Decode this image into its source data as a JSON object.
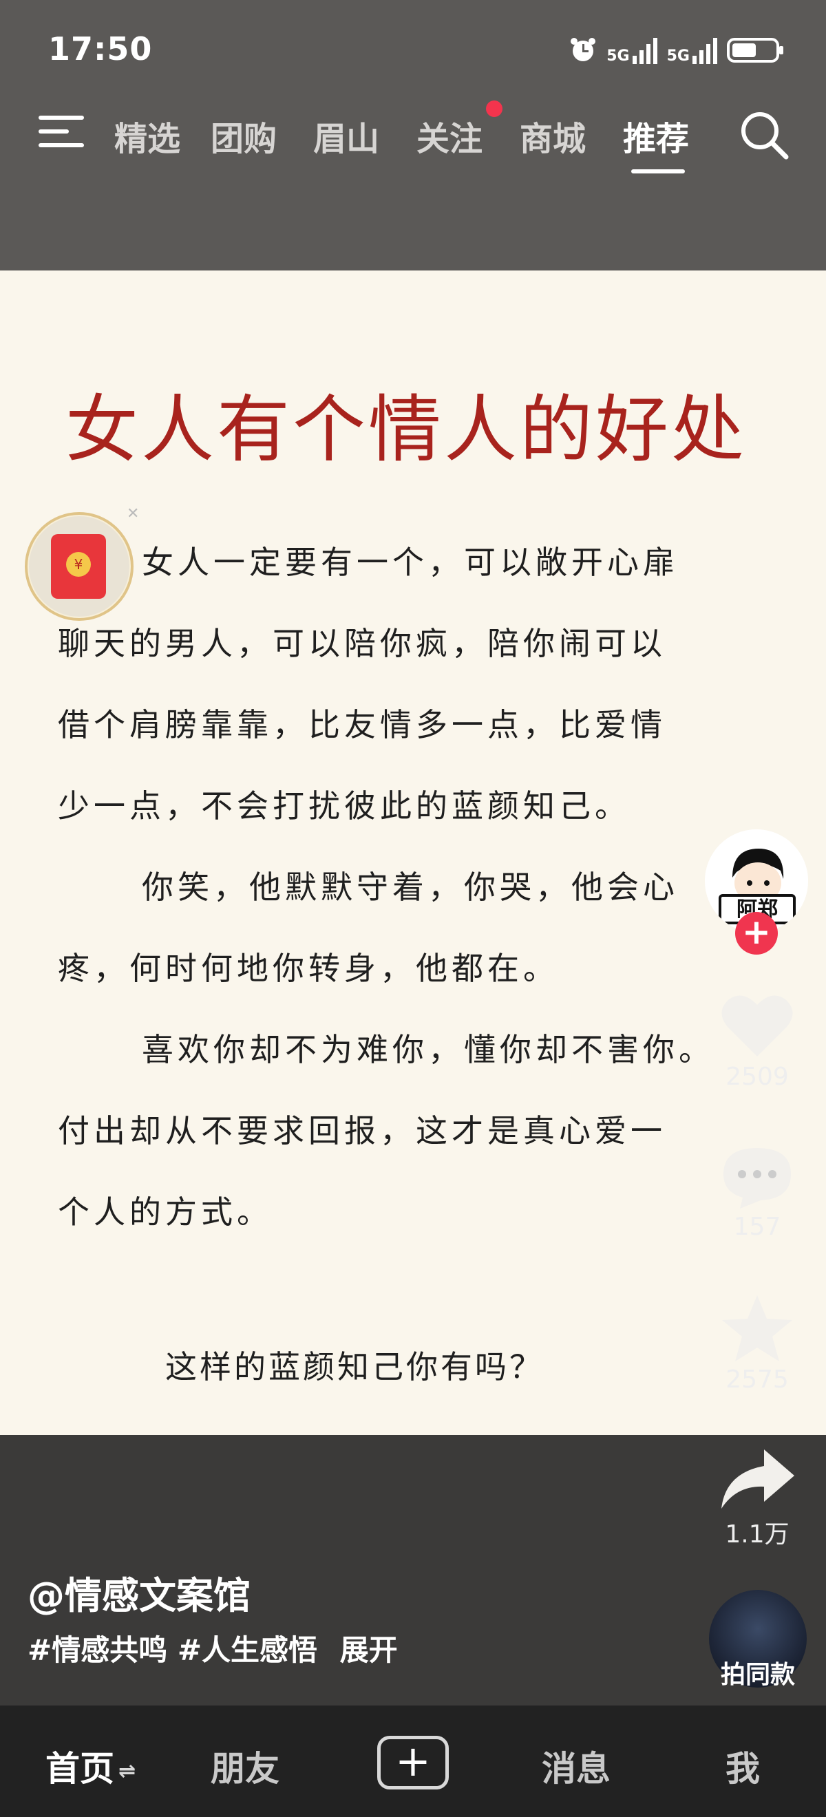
{
  "status_bar": {
    "time": "17:50",
    "net1": "5G",
    "net2": "5G"
  },
  "top_tabs": [
    "精选",
    "团购",
    "眉山",
    "关注",
    "商城",
    "推荐"
  ],
  "active_tab": "推荐",
  "post": {
    "title": "女人有个情人的好处",
    "lines": [
      "女人一定要有一个，可以敞开心扉",
      "聊天的男人，可以陪你疯，陪你闹可以",
      "借个肩膀靠靠，比友情多一点，比爱情",
      "少一点，不会打扰彼此的蓝颜知己。",
      "你笑，他默默守着，你哭，他会心",
      "疼，何时何地你转身，他都在。",
      "喜欢你却不为难你，懂你却不害你。",
      "付出却从不要求回报，这才是真心爱一",
      "个人的方式。"
    ],
    "question": "这样的蓝颜知己你有吗？"
  },
  "actions": {
    "likes": "2509",
    "comments": "157",
    "favorites": "2575",
    "shares": "1.1万",
    "remix_label": "拍同款"
  },
  "author": "@情感文案馆",
  "tags": [
    "#情感共鸣",
    "#人生感悟"
  ],
  "expand_label": "展开",
  "bottom_nav": [
    "首页",
    "朋友",
    "消息",
    "我"
  ]
}
